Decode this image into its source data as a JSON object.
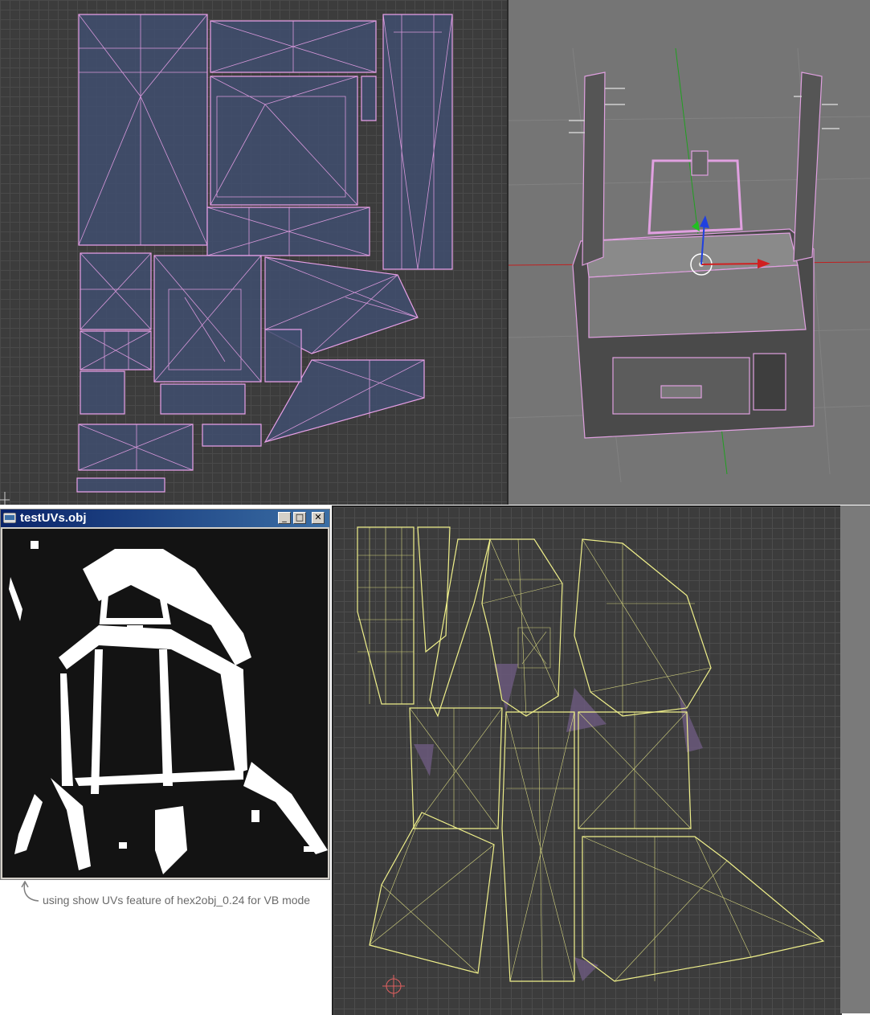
{
  "window": {
    "title": "testUVs.obj",
    "minimize_glyph": "_",
    "maximize_glyph": "□",
    "close_glyph": "✕"
  },
  "caption": "using show UVs feature of hex2obj_0.24 for VB mode",
  "colors": {
    "uv_wire_pink": "#e8a0e8",
    "uv_fill_blue": "#3f4d6e",
    "uv_wire_yellow": "#f0f08a",
    "uv_fill_purple": "#6d5a80",
    "axis_x": "#d02020",
    "axis_y": "#20c020",
    "axis_z": "#2040e0"
  },
  "icons": {
    "app": "application-icon",
    "arrow": "curved-arrow-icon",
    "cursor": "2d-cursor-icon"
  }
}
